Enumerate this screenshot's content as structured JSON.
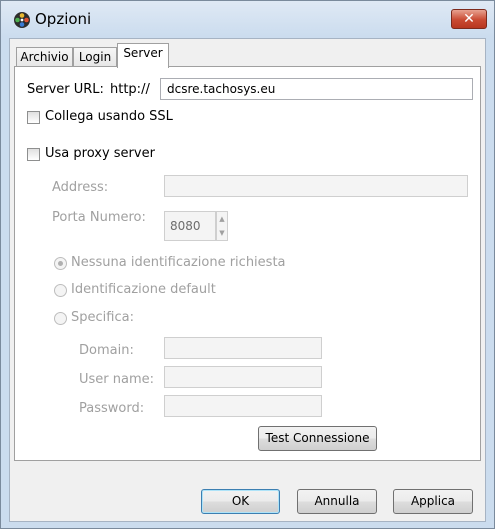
{
  "window": {
    "title": "Opzioni",
    "close_label": "✕"
  },
  "tabs": [
    {
      "label": "Archivio",
      "active": false
    },
    {
      "label": "Login",
      "active": false
    },
    {
      "label": "Server",
      "active": true
    }
  ],
  "server": {
    "url_label": "Server URL:",
    "prefix": "http://",
    "url_value": "dcsre.tachosys.eu",
    "ssl_label": "Collega usando SSL",
    "ssl_checked": false,
    "proxy_label": "Usa proxy server",
    "proxy_checked": false
  },
  "proxy": {
    "address_label": "Address:",
    "address_value": "",
    "port_label": "Porta Numero:",
    "port_value": "8080",
    "auth_options": [
      {
        "label": "Nessuna identificazione richiesta",
        "selected": true
      },
      {
        "label": "Identificazione default",
        "selected": false
      },
      {
        "label": "Specifica:",
        "selected": false
      }
    ],
    "domain_label": "Domain:",
    "domain_value": "",
    "username_label": "User name:",
    "username_value": "",
    "password_label": "Password:",
    "password_value": "",
    "test_label": "Test Connessione"
  },
  "footer": {
    "ok_label": "OK",
    "cancel_label": "Annulla",
    "apply_label": "Applica"
  },
  "icons": {
    "app": "film-reel-icon",
    "spin_up": "spin-up-icon",
    "spin_down": "spin-down-icon"
  },
  "colors": {
    "close": "#c94a32",
    "title_bar": "#cbdcee",
    "disabled_text": "#a0a0a0"
  }
}
